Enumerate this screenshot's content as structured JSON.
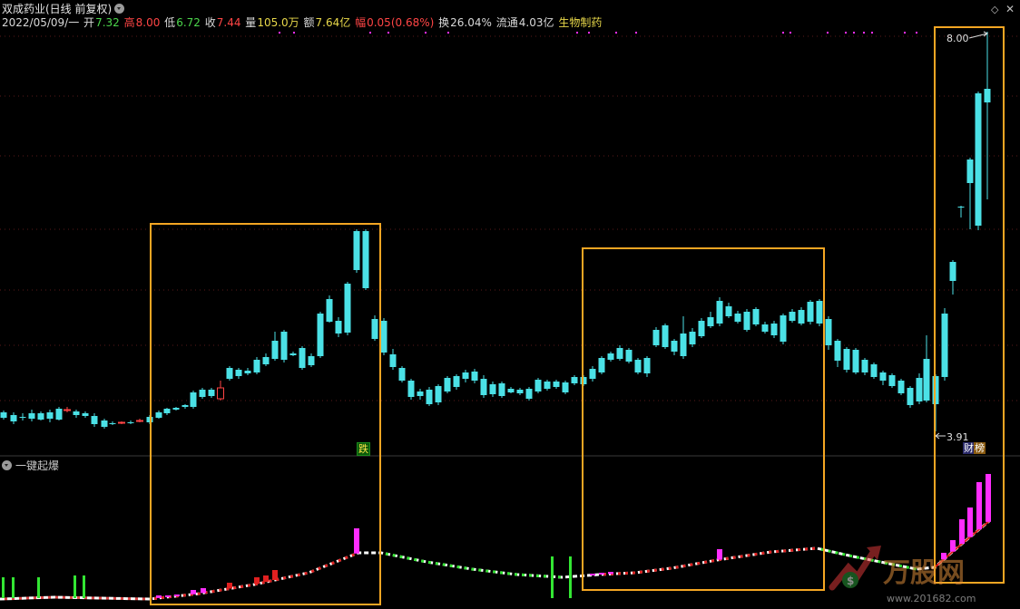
{
  "header": {
    "stock_title": "双成药业(日线 前复权)",
    "date": "2022/05/09/一",
    "open_label": "开",
    "open": "7.32",
    "high_label": "高",
    "high": "8.00",
    "low_label": "低",
    "low": "6.72",
    "close_label": "收",
    "close": "7.44",
    "volume_label": "量",
    "volume": "105.0万",
    "amount_label": "额",
    "amount": "7.64亿",
    "change_label": "幅",
    "change": "0.05(0.68%)",
    "turnover_label": "换",
    "turnover": "26.04%",
    "float_label": "流通",
    "float": "4.03亿",
    "industry": "生物制药"
  },
  "annotations": {
    "max_price": "8.00",
    "min_price": "3.91",
    "fall_tag": "跌",
    "report_tag": "财",
    "rank_tag": "榜"
  },
  "indicator": {
    "name": "一键起爆"
  },
  "watermark": {
    "brand": "万股网",
    "url": "www.201682.com"
  },
  "colors": {
    "up": "#ff4545",
    "down": "#4be1e6",
    "box": "#f5a623",
    "magenta": "#ff2dff",
    "green": "#33e633"
  }
}
